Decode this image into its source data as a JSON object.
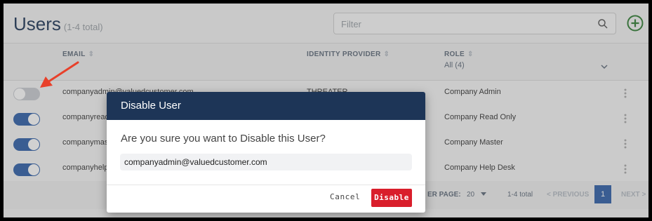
{
  "header": {
    "title": "Users",
    "count": "(1-4 total)",
    "filter_placeholder": "Filter"
  },
  "columns": {
    "email": "EMAIL",
    "identity_provider": "IDENTITY PROVIDER",
    "role": "ROLE",
    "role_filter": "All (4)"
  },
  "rows": [
    {
      "email": "companyadmin@valuedcustomer.com",
      "identity_provider": "THREATER",
      "role": "Company Admin",
      "enabled": false
    },
    {
      "email": "companyread",
      "identity_provider": "",
      "role": "Company Read Only",
      "enabled": true
    },
    {
      "email": "companymast",
      "identity_provider": "",
      "role": "Company Master",
      "enabled": true
    },
    {
      "email": "companyhelp",
      "identity_provider": "",
      "role": "Company Help Desk",
      "enabled": true
    }
  ],
  "pagination": {
    "per_page_label": "ER PAGE:",
    "per_page_value": "20",
    "total": "1-4 total",
    "previous": "< PREVIOUS",
    "page": "1",
    "next": "NEXT >"
  },
  "modal": {
    "title": "Disable User",
    "question": "Are you sure you want to Disable this User?",
    "email": "companyadmin@valuedcustomer.com",
    "cancel_label": "Cancel",
    "disable_label": "Disable"
  },
  "colors": {
    "accent": "#1d3557",
    "toggle_on": "#2e5fa8",
    "danger": "#d91e2b",
    "add_icon": "#2e7d32",
    "arrow": "#e8402a"
  }
}
